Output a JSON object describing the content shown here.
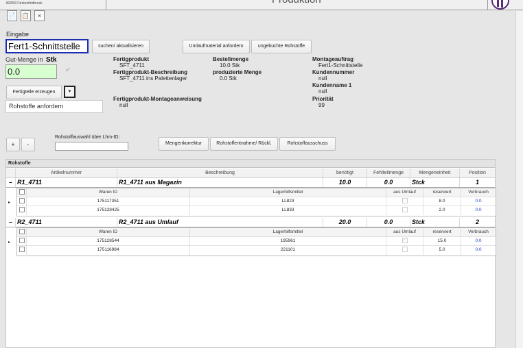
{
  "header": {
    "address": "83250 Fürstenfeldbruck",
    "title": "Produktion"
  },
  "toolbar": {
    "icon1": "📄",
    "icon2": "📋",
    "close": "×"
  },
  "eingabe": {
    "label": "Eingabe",
    "value": "Fert1-Schnittstelle",
    "search_button": "suchen/ aktualisieren"
  },
  "gut_menge": {
    "label": "Gut-Menge in",
    "unit": "Stk",
    "value": "0.0",
    "check": "✔"
  },
  "buttons": {
    "fertigteile": "Fertigteile erzeugen",
    "dropdown": "▼",
    "umlauf": "Umlaufmaterial anfordern",
    "ungebucht": "ungebuchte Rohstoffe",
    "plus": "+",
    "minus": "-",
    "mengenkorrektur": "Mengenkorrektur",
    "entnahme": "Rohstoffentnahme/ Rückl.",
    "ausschuss": "Rohstoffausschuss"
  },
  "rohstoffe_field": "Rohstoffe anfordern",
  "lhm_label": "Rohstoffauswahl über Lhm-ID:",
  "info": {
    "fertigprodukt_label": "Fertigprodukt",
    "fertigprodukt_value": "SFT_4711",
    "beschreibung_label": "Fertigprodukt-Beschreibung",
    "beschreibung_value": "SFT_4711 ins Palettenlager",
    "montageanweisung_label": "Fertigprodukt-Montageanweisung",
    "montageanweisung_value": "null",
    "bestellmenge_label": "Bestellmenge",
    "bestellmenge_value": "10.0 Stk",
    "produzierte_label": "produzierte Menge",
    "produzierte_value": "0.0 Stk",
    "montageauftrag_label": "Montageauftrag",
    "montageauftrag_value": "Fert1-Schnittstelle",
    "kundennummer_label": "Kundennummer",
    "kundennummer_value": "null",
    "kundenname_label": "Kundenname 1",
    "kundenname_value": "null",
    "prioritaet_label": "Priorität",
    "prioritaet_value": "99"
  },
  "grid": {
    "title": "Rohstoffe",
    "columns": [
      "Artikelnummer",
      "Beschreibung",
      "benötigt",
      "Fehlteilmenge",
      "Mengeneinheit",
      "Position"
    ],
    "sub_columns": [
      "Waren ID",
      "Lagerhilfsmittel",
      "aus Umlauf",
      "reserviert",
      "Verbrauch"
    ],
    "groups": [
      {
        "toggle": "–",
        "artikel": "R1_4711",
        "beschreibung": "R1_4711 aus Magazin",
        "benoetigt": "10.0",
        "fehl": "0.0",
        "einheit": "Stck",
        "position": "1",
        "items": [
          {
            "waren_id": "175117351",
            "lhm": "LL823",
            "aus_umlauf": false,
            "reserviert": "8.0",
            "verbrauch": "0.0"
          },
          {
            "waren_id": "175128425",
            "lhm": "LL833",
            "aus_umlauf": false,
            "reserviert": "2.0",
            "verbrauch": "0.0"
          }
        ]
      },
      {
        "toggle": "–",
        "artikel": "R2_4711",
        "beschreibung": "R2_4711 aus Umlauf",
        "benoetigt": "20.0",
        "fehl": "0.0",
        "einheit": "Stck",
        "position": "2",
        "items": [
          {
            "waren_id": "175128544",
            "lhm": "195961",
            "aus_umlauf": true,
            "reserviert": "15.0",
            "verbrauch": "0.0"
          },
          {
            "waren_id": "175116984",
            "lhm": "221101",
            "aus_umlauf": false,
            "reserviert": "5.0",
            "verbrauch": "0.0"
          }
        ]
      }
    ]
  },
  "colors": {
    "input_border": "#1a2fb0",
    "qty_bg": "#d8ffd0",
    "link_blue": "#1a3fc0",
    "logo": "#5a2a7a"
  }
}
